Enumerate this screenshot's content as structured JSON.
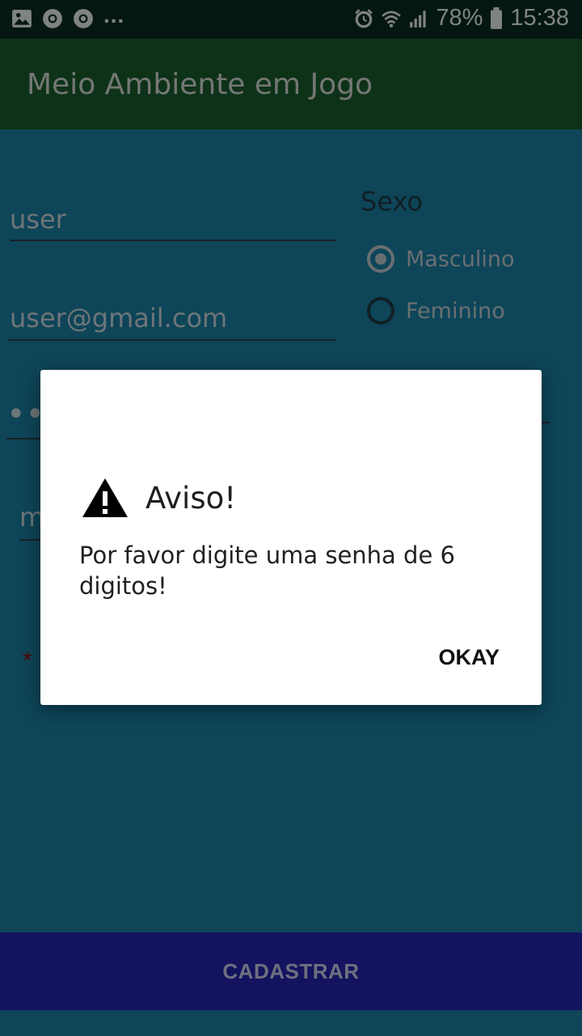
{
  "status_bar": {
    "battery": "78%",
    "time": "15:38",
    "more": "...",
    "icons": [
      "image-icon",
      "chrome-icon",
      "chrome-icon",
      "alarm-icon",
      "wifi-icon",
      "signal-icon",
      "battery-icon"
    ]
  },
  "app_bar": {
    "title": "Meio Ambiente em Jogo"
  },
  "form": {
    "username": "user",
    "email": "user@gmail.com",
    "password_mask": "••••",
    "partial_field": "m",
    "required_marker": "*",
    "sexo_label": "Sexo",
    "sexo_options": [
      {
        "label": "Masculino",
        "selected": true
      },
      {
        "label": "Feminino",
        "selected": false
      }
    ],
    "register_button": "CADASTRAR"
  },
  "dialog": {
    "title": "Aviso!",
    "message": "Por favor digite uma senha de 6 digitos!",
    "ok_button": "OKAY",
    "icon": "warning-icon"
  },
  "colors": {
    "app_bar": "#1a5c2c",
    "background": "#1a7fa0",
    "button": "#2323b0",
    "status_bar": "#0a2b22"
  }
}
